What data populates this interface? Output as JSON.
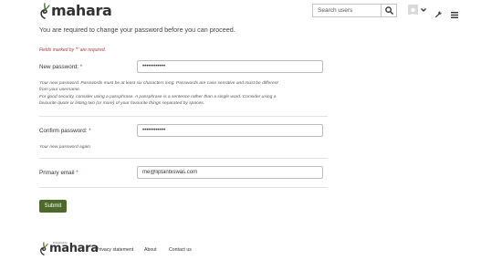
{
  "header": {
    "logo_text": "mahara",
    "search": {
      "placeholder": "Search users"
    },
    "icons": {
      "search": "search-icon",
      "avatar": "avatar-icon",
      "user_menu": "chevron-down-icon",
      "admin": "wrench-icon",
      "menu": "hamburger-icon"
    }
  },
  "main": {
    "notice": "You are required to change your password before you can proceed.",
    "required_note": "Fields marked by '*' are required.",
    "new_password": {
      "label": "New password:",
      "required_mark": "*",
      "value": "••••••••••••",
      "description_lines": [
        "Your new password. Passwords must be at least six characters long. Passwords are case sensitive and must be different",
        "from your username.",
        "For good security, consider using a passphrase. A passphrase is a sentence rather than a single word. Consider using a",
        "favourite quote or listing two (or more) of your favourite things separated by spaces."
      ]
    },
    "confirm_password": {
      "label": "Confirm password:",
      "required_mark": "*",
      "value": "••••••••••••",
      "description": "Your new password again"
    },
    "primary_email": {
      "label": "Primary email",
      "required_mark": "*",
      "value": "me@liptanbiswas.com"
    },
    "submit_label": "Submit"
  },
  "footer": {
    "logo_text": "mahara",
    "powered_by": "Powered by",
    "links": [
      "Privacy statement",
      "About",
      "Contact us"
    ]
  },
  "colors": {
    "brand_green": "#4e6a2b",
    "required_red": "#b33939"
  }
}
